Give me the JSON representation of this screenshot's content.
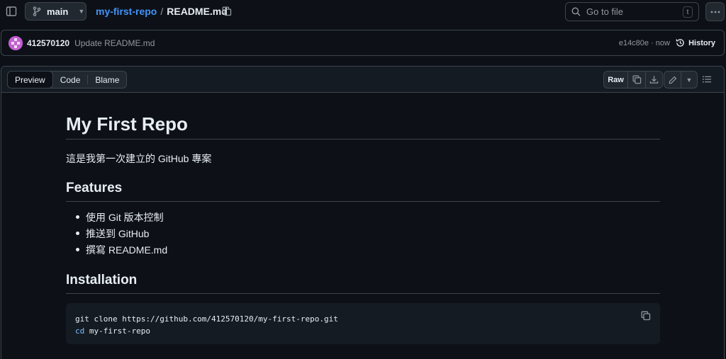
{
  "topbar": {
    "branch": "main",
    "repo": "my-first-repo",
    "separator": "/",
    "file": "README.md",
    "search_placeholder": "Go to file",
    "search_shortcut": "t"
  },
  "commit": {
    "user": "412570120",
    "message": "Update README.md",
    "meta": "e14c80e · now",
    "history_label": "History"
  },
  "file_header": {
    "tabs": [
      "Preview",
      "Code",
      "Blame"
    ],
    "raw_label": "Raw"
  },
  "readme": {
    "title": "My First Repo",
    "intro": "這是我第一次建立的 GitHub 專案",
    "features_heading": "Features",
    "features": [
      "使用 Git 版本控制",
      "推送到 GitHub",
      "撰寫 README.md"
    ],
    "install_heading": "Installation",
    "code_line1": "git clone https://github.com/412570120/my-first-repo.git",
    "code_line2_kw": "cd",
    "code_line2_rest": " my-first-repo"
  },
  "colors": {
    "background": "#0d1117",
    "link": "#4493f8",
    "border": "#3d444d",
    "code_keyword": "#79c0ff"
  }
}
